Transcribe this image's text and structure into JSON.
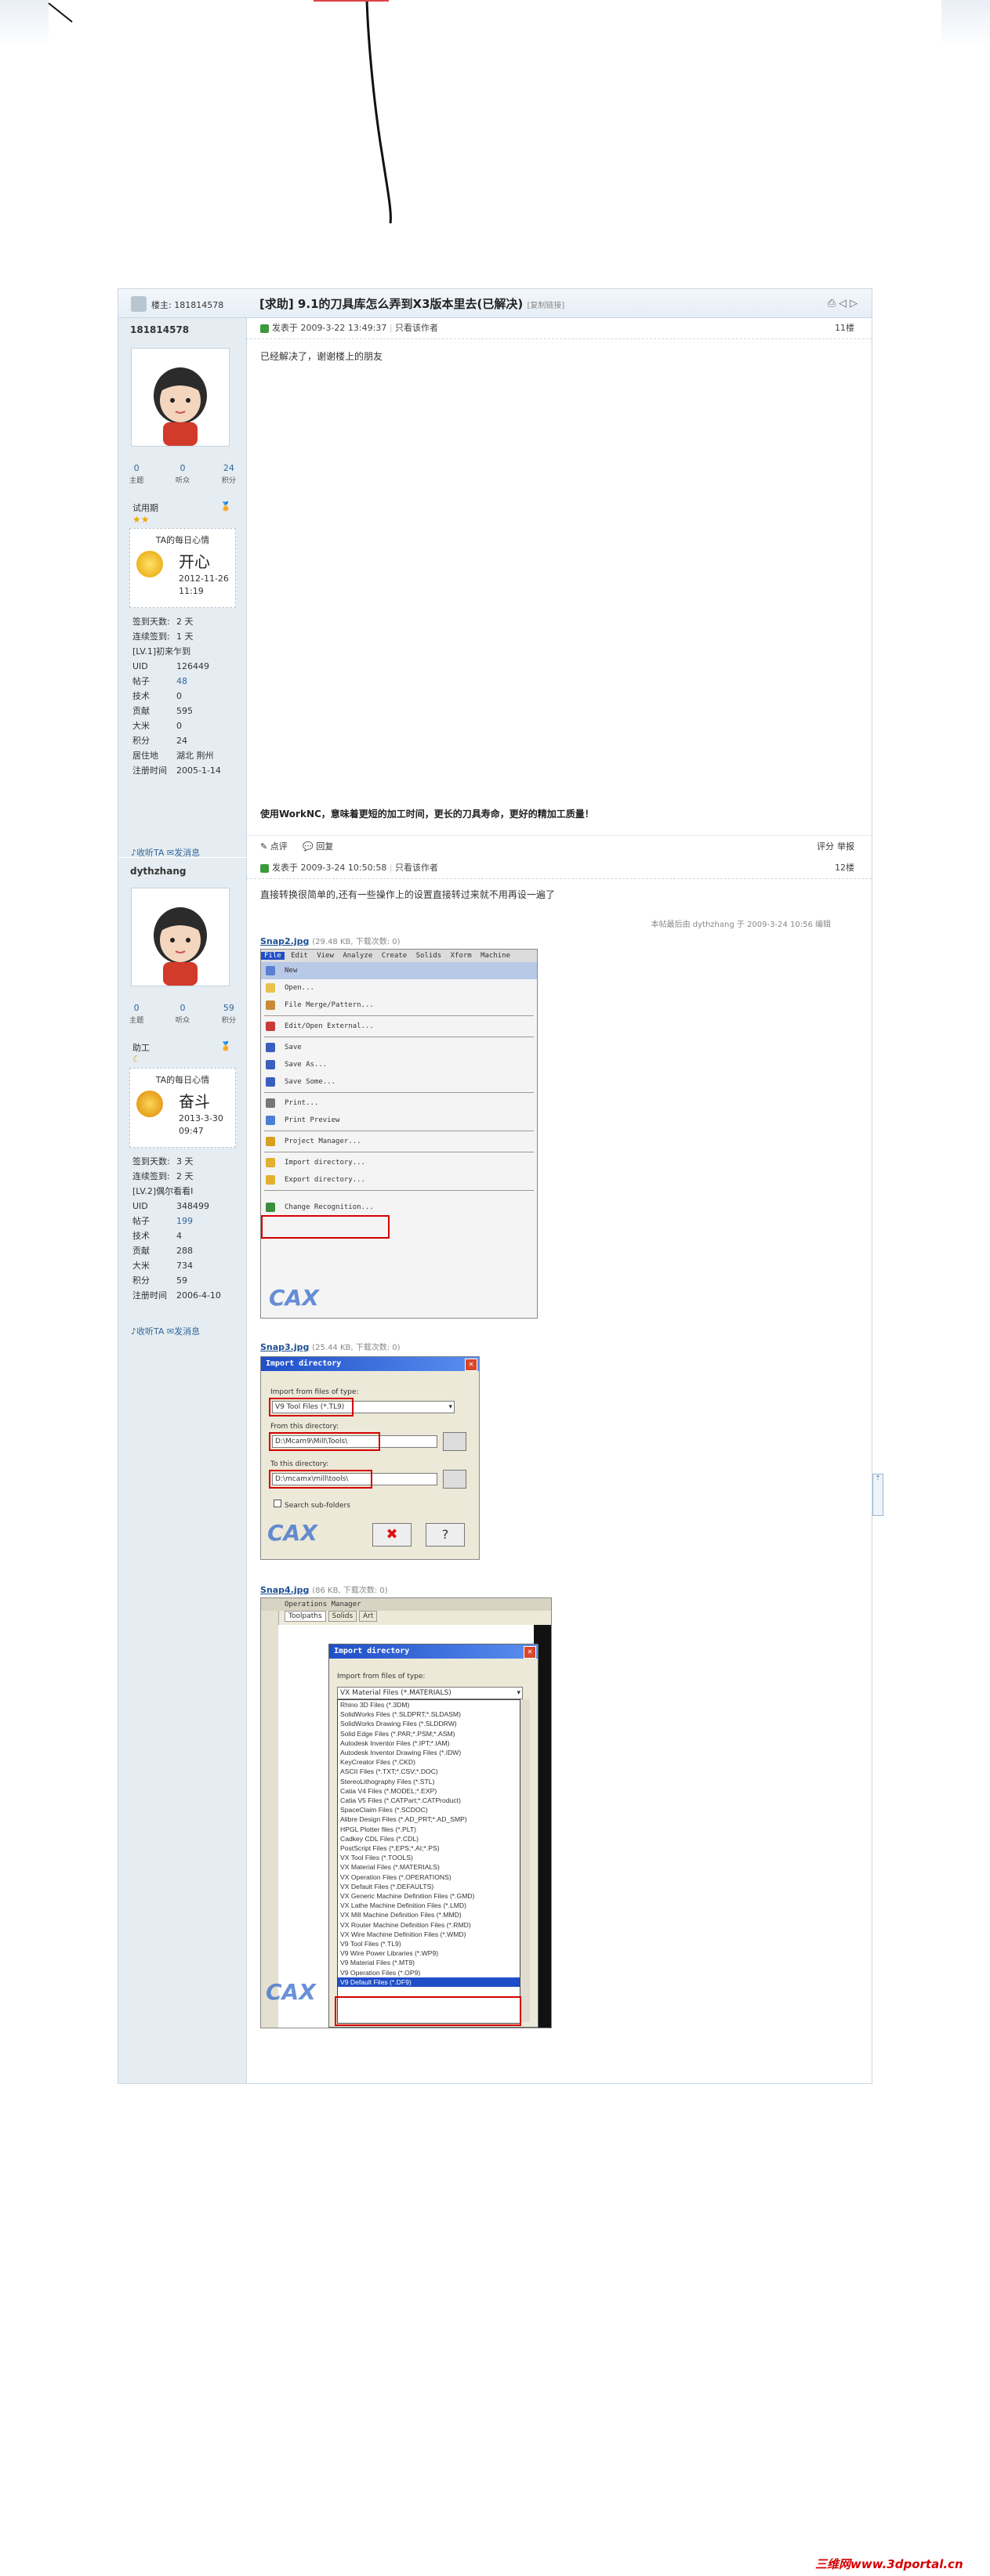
{
  "thread": {
    "owner_label": "楼主: 181814578",
    "title": "[求助] 9.1的刀具库怎么弄到X3版本里去(已解决)",
    "copy_link": "[复制链接]"
  },
  "posts": [
    {
      "username": "181814578",
      "stats": [
        {
          "value": "0",
          "label": "主题"
        },
        {
          "value": "0",
          "label": "听众"
        },
        {
          "value": "24",
          "label": "积分"
        }
      ],
      "rank": "试用期",
      "mood_title": "TA的每日心情",
      "mood": "开心",
      "mood_date": "2012-11-26 11:19",
      "info": [
        {
          "k": "签到天数:",
          "v": "2 天"
        },
        {
          "k": "连续签到:",
          "v": "1 天"
        },
        {
          "k": "[LV.1]初来乍到",
          "v": ""
        },
        {
          "k": "UID",
          "v": "126449"
        },
        {
          "k": "帖子",
          "v": "48"
        },
        {
          "k": "技术",
          "v": "0"
        },
        {
          "k": "贡献",
          "v": "595"
        },
        {
          "k": "大米",
          "v": "0"
        },
        {
          "k": "积分",
          "v": "24"
        },
        {
          "k": "居住地",
          "v": "湖北 荆州"
        },
        {
          "k": "注册时间",
          "v": "2005-1-14"
        }
      ],
      "listen": "收听TA",
      "message": "发消息",
      "posted": "发表于 2009-3-22 13:49:37",
      "author_only": "只看该作者",
      "floor": "11楼",
      "content": "已经解决了，谢谢楼上的朋友",
      "signature": "使用WorkNC，意味着更短的加工时间，更长的刀具寿命，更好的精加工质量！",
      "rate": "点评",
      "reply": "回复",
      "score": "评分",
      "report": "举报"
    },
    {
      "username": "dythzhang",
      "stats": [
        {
          "value": "0",
          "label": "主题"
        },
        {
          "value": "0",
          "label": "听众"
        },
        {
          "value": "59",
          "label": "积分"
        }
      ],
      "rank": "助工",
      "mood_title": "TA的每日心情",
      "mood": "奋斗",
      "mood_date": "2013-3-30 09:47",
      "info": [
        {
          "k": "签到天数:",
          "v": "3 天"
        },
        {
          "k": "连续签到:",
          "v": "2 天"
        },
        {
          "k": "[LV.2]偶尔看看I",
          "v": ""
        },
        {
          "k": "UID",
          "v": "348499"
        },
        {
          "k": "帖子",
          "v": "199"
        },
        {
          "k": "技术",
          "v": "4"
        },
        {
          "k": "贡献",
          "v": "288"
        },
        {
          "k": "大米",
          "v": "734"
        },
        {
          "k": "积分",
          "v": "59"
        },
        {
          "k": "注册时间",
          "v": "2006-4-10"
        }
      ],
      "listen": "收听TA",
      "message": "发消息",
      "posted": "发表于 2009-3-24 10:50:58",
      "author_only": "只看该作者",
      "floor": "12楼",
      "content": "直接转换很简单的,还有一些操作上的设置直接转过来就不用再设一遍了",
      "edited": "本帖最后由 dythzhang 于 2009-3-24 10:56 编辑",
      "attachments": [
        {
          "name": "Snap2.jpg",
          "meta": "(29.48 KB, 下载次数: 0)"
        },
        {
          "name": "Snap3.jpg",
          "meta": "(25.44 KB, 下载次数: 0)"
        },
        {
          "name": "Snap4.jpg",
          "meta": "(86 KB, 下载次数: 0)"
        }
      ]
    }
  ],
  "snap2": {
    "menubar": [
      "File",
      "Edit",
      "View",
      "Analyze",
      "Create",
      "Solids",
      "Xform",
      "Machine"
    ],
    "items": [
      "New",
      "Open...",
      "File Merge/Pattern...",
      "Edit/Open External...",
      "Save",
      "Save As...",
      "Save Some...",
      "Print...",
      "Print Preview",
      "Project Manager...",
      "Import directory...",
      "Export directory...",
      "Change Recognition..."
    ]
  },
  "snap3": {
    "title": "Import directory",
    "type_label": "Import from files of type:",
    "type_value": "V9 Tool Files (*.TL9)",
    "from_label": "From this directory:",
    "from_value": "D:\\Mcam9\\Mill\\Tools\\",
    "to_label": "To this directory:",
    "to_value": "D:\\mcamx\\mill\\tools\\",
    "subfolders": "Search sub-folders"
  },
  "snap4": {
    "manager_title": "Operations Manager",
    "tabs": [
      "Toolpaths",
      "Solids",
      "Art"
    ],
    "dialog_title": "Import directory",
    "type_label": "Import from files of type:",
    "selected": "VX Material Files (*.MATERIALS)",
    "list": [
      "Rhino 3D Files (*.3DM)",
      "SolidWorks Files (*.SLDPRT;*.SLDASM)",
      "SolidWorks Drawing Files (*.SLDDRW)",
      "Solid Edge Files (*.PAR;*.PSM;*.ASM)",
      "Autodesk Inventor Files (*.IPT;*.IAM)",
      "Autodesk Inventor Drawing Files (*.IDW)",
      "KeyCreator Files (*.CKD)",
      "ASCII Files (*.TXT;*.CSV;*.DOC)",
      "StereoLithography Files (*.STL)",
      "Catia V4 Files (*.MODEL;*.EXP)",
      "Catia V5 Files (*.CATPart;*.CATProduct)",
      "SpaceClaim Files (*.SCDOC)",
      "Alibre Design Files (*.AD_PRT;*.AD_SMP)",
      "HPGL Plotter files (*.PLT)",
      "Cadkey CDL Files (*.CDL)",
      "PostScript Files (*.EPS;*.AI;*.PS)",
      "VX Tool Files (*.TOOLS)",
      "VX Material Files (*.MATERIALS)",
      "VX Operation Files (*.OPERATIONS)",
      "VX Default Files (*.DEFAULTS)",
      "VX Generic Machine Definition Files (*.GMD)",
      "VX Lathe Machine Definition Files (*.LMD)",
      "VX Mill Machine Definition Files (*.MMD)",
      "VX Router Machine Definition Files (*.RMD)",
      "VX Wire Machine Definition Files (*.WMD)",
      "V9 Tool Files (*.TL9)",
      "V9 Wire Power Libraries (*.WP9)",
      "V9 Material Files (*.MT9)",
      "V9 Operation Files (*.OP9)",
      "V9 Default Files (*.DF9)"
    ]
  },
  "watermark": "三维网www.3dportal.cn",
  "colors": {
    "accent": "#1c4f93",
    "side_bg": "#e5edf2",
    "highlight": "#d40000"
  }
}
